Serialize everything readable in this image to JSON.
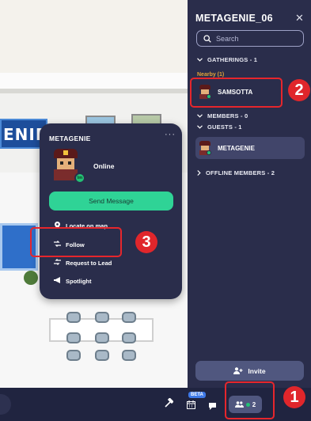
{
  "world": {
    "banner_text": "ENIE"
  },
  "panel": {
    "title": "METAGENIE_06",
    "search_placeholder": "Search",
    "sections": {
      "gatherings": "GATHERINGS - 1",
      "nearby": "Nearby (1)",
      "members": "MEMBERS - 0",
      "guests": "GUESTS - 1",
      "offline": "OFFLINE MEMBERS - 2"
    },
    "nearby_user": "SAMSOTTA",
    "guest_user": "METAGENIE",
    "invite_label": "Invite"
  },
  "card": {
    "name": "METAGENIE",
    "more": "···",
    "status": "Online",
    "avatar_badge": "lm",
    "send_label": "Send Message",
    "menu": [
      "Locate on map",
      "Follow",
      "Request to Lead",
      "Spotlight"
    ]
  },
  "bottombar": {
    "beta_label": "BETA",
    "members_count": "2"
  },
  "callouts": [
    "1",
    "2",
    "3"
  ],
  "colors": {
    "panel_bg": "#2a2d4b",
    "accent_green": "#2fd396",
    "nearby_label": "#e0a237",
    "callout_red": "#e6262c"
  }
}
